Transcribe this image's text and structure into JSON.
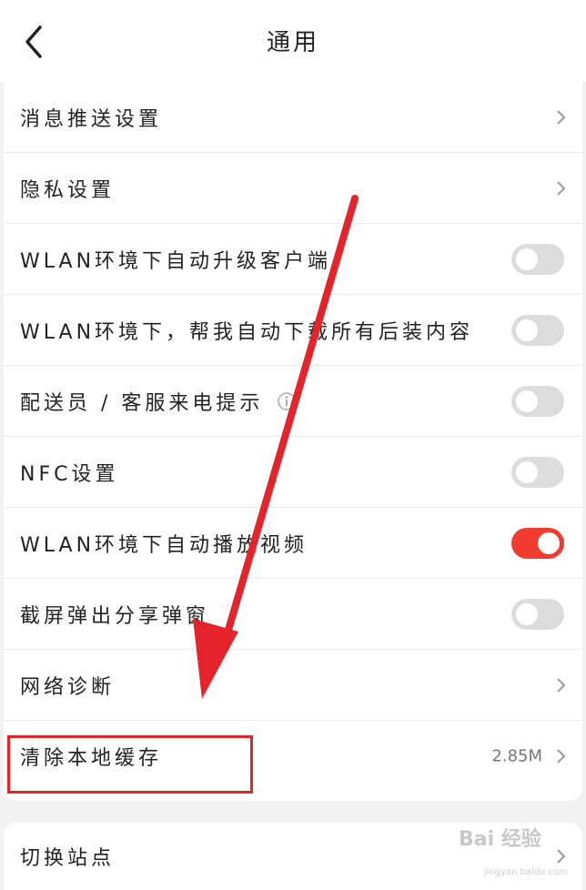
{
  "header": {
    "title": "通用",
    "back_icon": "chevron-left-icon"
  },
  "settings": {
    "push": {
      "label": "消息推送设置"
    },
    "privacy": {
      "label": "隐私设置"
    },
    "wlan_auto_upgrade": {
      "label": "WLAN环境下自动升级客户端",
      "enabled": false
    },
    "wlan_auto_download": {
      "label": "WLAN环境下，帮我自动下载所有后装内容",
      "enabled": false
    },
    "call_reminder": {
      "label": "配送员 / 客服来电提示",
      "enabled": false,
      "info_icon": "info-icon"
    },
    "nfc": {
      "label": "NFC设置",
      "enabled": false
    },
    "wlan_autoplay": {
      "label": "WLAN环境下自动播放视频",
      "enabled": true
    },
    "screenshot_share": {
      "label": "截屏弹出分享弹窗",
      "enabled": false
    },
    "network_diag": {
      "label": "网络诊断"
    },
    "clear_cache": {
      "label": "清除本地缓存",
      "value": "2.85M"
    }
  },
  "site": {
    "switch_label": "切换站点"
  },
  "watermark": {
    "text": "Bai 经验",
    "sub": "jingyan.baidu.com"
  },
  "colors": {
    "accent": "#f23b30",
    "toggle_off": "#dcdcdc",
    "annotation": "#e5232b"
  }
}
